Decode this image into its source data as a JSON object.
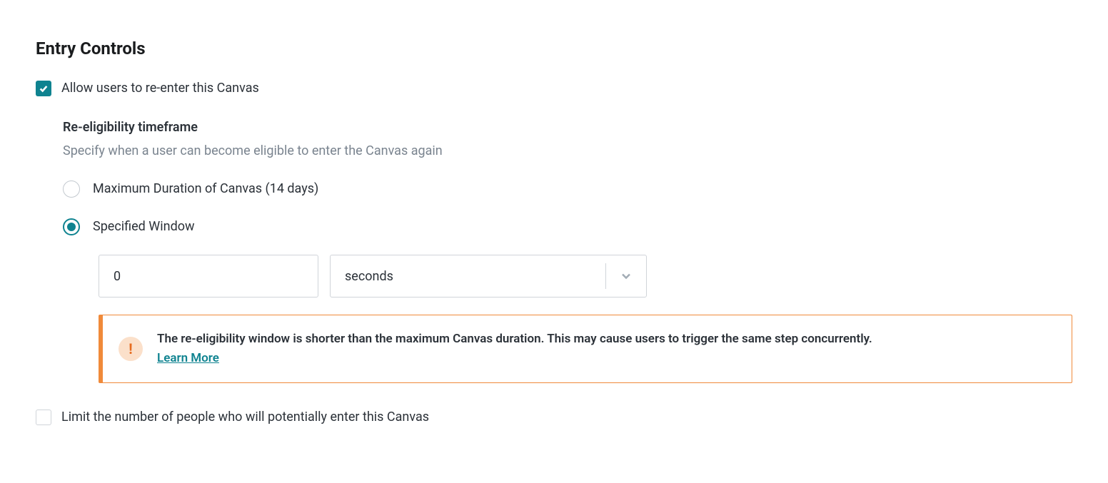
{
  "section": {
    "title": "Entry Controls",
    "allow_reenter": {
      "checked": true,
      "label": "Allow users to re-enter this Canvas"
    },
    "reeligibility": {
      "heading": "Re-eligibility timeframe",
      "description": "Specify when a user can become eligible to enter the Canvas again",
      "options": {
        "max_duration": {
          "selected": false,
          "label": "Maximum Duration of Canvas (14 days)"
        },
        "specified_window": {
          "selected": true,
          "label": "Specified Window",
          "value": "0",
          "unit": "seconds"
        }
      },
      "warning": {
        "message": "The re-eligibility window is shorter than the maximum Canvas duration. This may cause users to trigger the same step concurrently.",
        "learn_more": "Learn More"
      }
    },
    "limit_people": {
      "checked": false,
      "label": "Limit the number of people who will potentially enter this Canvas"
    }
  }
}
